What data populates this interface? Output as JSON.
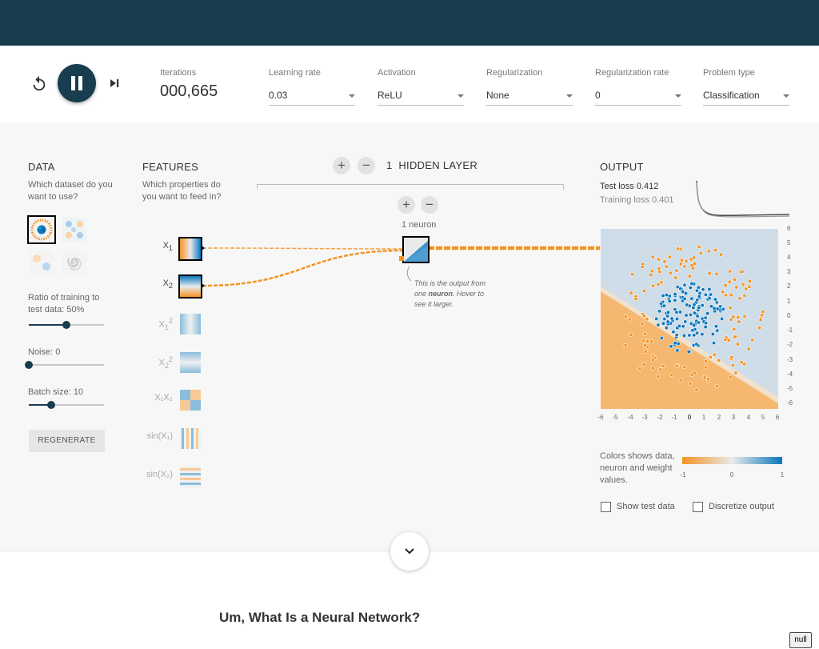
{
  "controls": {
    "iterations_label": "Iterations",
    "iterations_value": "000,665",
    "learning_rate_label": "Learning rate",
    "learning_rate_value": "0.03",
    "activation_label": "Activation",
    "activation_value": "ReLU",
    "regularization_label": "Regularization",
    "regularization_value": "None",
    "regularization_rate_label": "Regularization rate",
    "regularization_rate_value": "0",
    "problem_type_label": "Problem type",
    "problem_type_value": "Classification"
  },
  "data_panel": {
    "title": "DATA",
    "question": "Which dataset do you want to use?",
    "ratio_label": "Ratio of training to test data:",
    "ratio_value": "50%",
    "ratio_fraction": 0.5,
    "noise_label": "Noise:",
    "noise_value": "0",
    "noise_fraction": 0,
    "batch_label": "Batch size:",
    "batch_value": "10",
    "batch_fraction": 0.3,
    "regenerate_label": "REGENERATE"
  },
  "features": {
    "title": "FEATURES",
    "question": "Which properties do you want to feed in?",
    "items": [
      {
        "base": "X",
        "sub": "1",
        "sup": "",
        "active": true
      },
      {
        "base": "X",
        "sub": "2",
        "sup": "",
        "active": true
      },
      {
        "base": "X",
        "sub": "1",
        "sup": "2",
        "active": false
      },
      {
        "base": "X",
        "sub": "2",
        "sup": "2",
        "active": false
      },
      {
        "base": "X₁X₂",
        "sub": "",
        "sup": "",
        "active": false
      },
      {
        "base": "sin(X₁)",
        "sub": "",
        "sup": "",
        "active": false
      },
      {
        "base": "sin(X₂)",
        "sub": "",
        "sup": "",
        "active": false
      }
    ]
  },
  "network": {
    "hidden_layer_count": "1",
    "hidden_layer_label": "HIDDEN LAYER",
    "neuron_label": "1 neuron",
    "annotation_pre": "This is the output from one ",
    "annotation_bold": "neuron",
    "annotation_post": ". Hover to see it larger."
  },
  "output": {
    "title": "OUTPUT",
    "test_loss_label": "Test loss",
    "test_loss_value": "0.412",
    "training_loss_label": "Training loss",
    "training_loss_value": "0.401",
    "y_ticks": [
      "6",
      "5",
      "4",
      "3",
      "2",
      "1",
      "0",
      "-1",
      "-2",
      "-3",
      "-4",
      "-5",
      "-6"
    ],
    "x_ticks": [
      "-6",
      "-5",
      "-4",
      "-3",
      "-2",
      "-1",
      "0",
      "1",
      "2",
      "3",
      "4",
      "5",
      "6"
    ],
    "colors_legend": "Colors shows data, neuron and weight values.",
    "scale_min": "-1",
    "scale_mid": "0",
    "scale_max": "1",
    "show_test_label": "Show test data",
    "discretize_label": "Discretize output"
  },
  "colors": {
    "orange": "#f59322",
    "blue": "#0877bd",
    "dark": "#183d4e"
  },
  "article": {
    "title": "Um, What Is a Neural Network?"
  },
  "badge": {
    "text": "null"
  }
}
